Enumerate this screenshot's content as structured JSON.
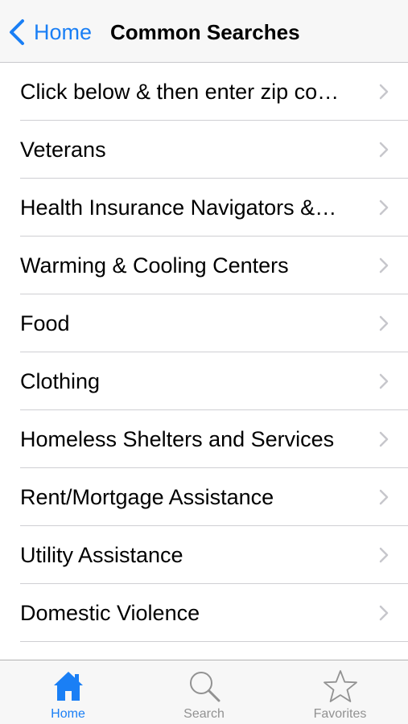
{
  "navbar": {
    "back_label": "Home",
    "title": "Common Searches"
  },
  "colors": {
    "accent": "#1a7ff5",
    "inactive": "#929292",
    "chevron": "#c7c7cc"
  },
  "list": {
    "items": [
      {
        "label": "Click below & then enter zip co…"
      },
      {
        "label": "Veterans"
      },
      {
        "label": "Health Insurance Navigators &…"
      },
      {
        "label": "Warming & Cooling Centers"
      },
      {
        "label": "Food"
      },
      {
        "label": "Clothing"
      },
      {
        "label": "Homeless Shelters and Services"
      },
      {
        "label": "Rent/Mortgage Assistance"
      },
      {
        "label": "Utility Assistance"
      },
      {
        "label": "Domestic Violence"
      }
    ]
  },
  "tabbar": {
    "tabs": [
      {
        "label": "Home",
        "icon": "home-icon",
        "active": true
      },
      {
        "label": "Search",
        "icon": "search-icon",
        "active": false
      },
      {
        "label": "Favorites",
        "icon": "star-icon",
        "active": false
      }
    ]
  }
}
